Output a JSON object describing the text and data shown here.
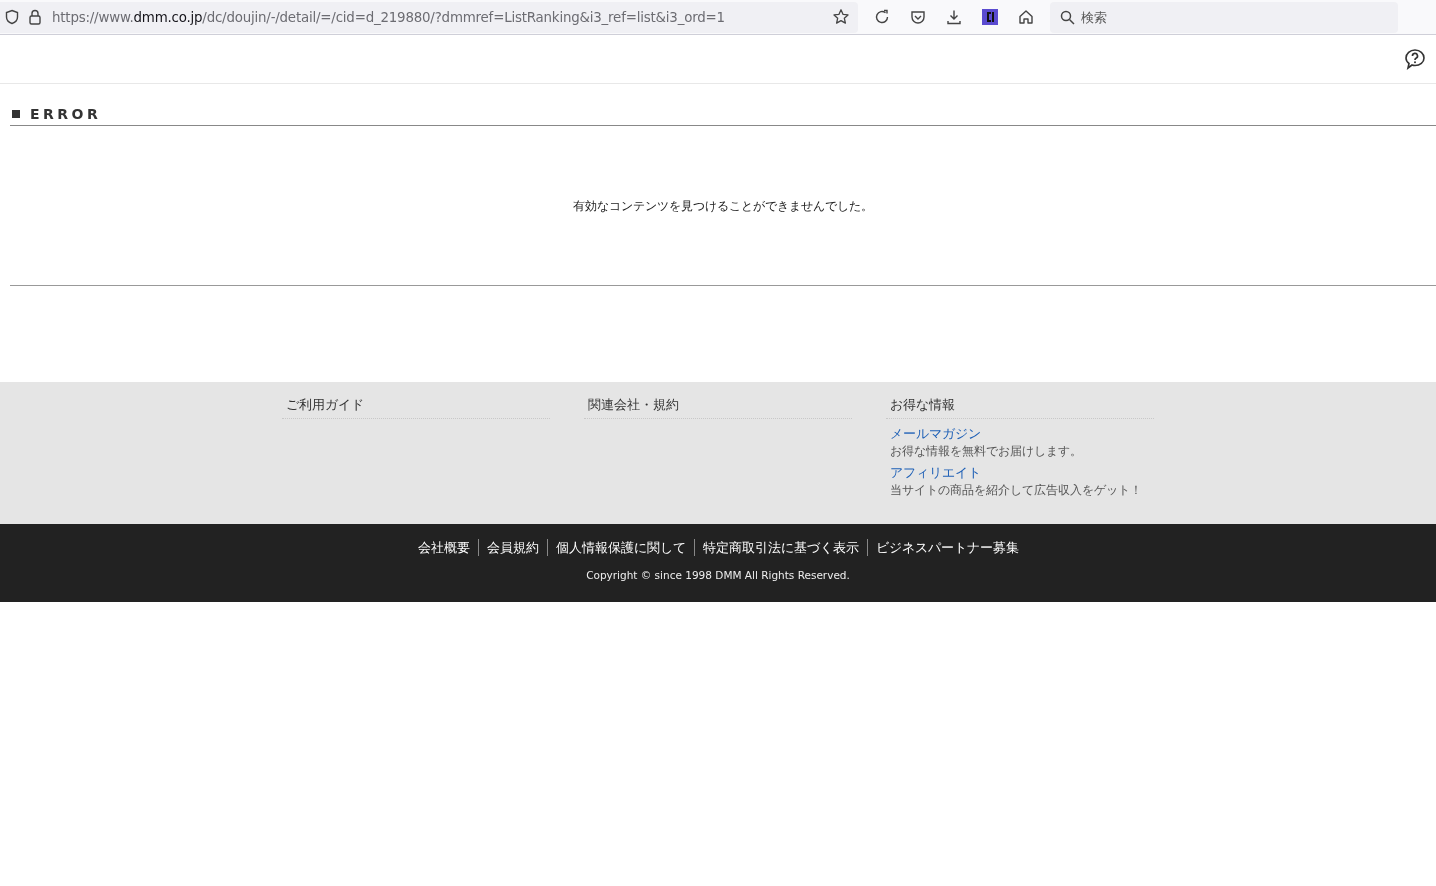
{
  "browser": {
    "url_prefix": "https://www.",
    "url_domain": "dmm.co.jp",
    "url_path": "/dc/doujin/-/detail/=/cid=d_219880/?dmmref=ListRanking&i3_ref=list&i3_ord=1",
    "search_placeholder": "検索"
  },
  "error": {
    "title": "ERROR",
    "message": "有効なコンテンツを見つけることができませんでした。"
  },
  "footer_columns": [
    {
      "heading": "ご利用ガイド"
    },
    {
      "heading": "関連会社・規約"
    },
    {
      "heading": "お得な情報",
      "links": [
        {
          "label": "メールマガジン",
          "description": "お得な情報を無料でお届けします。"
        },
        {
          "label": "アフィリエイト",
          "description": "当サイトの商品を紹介して広告収入をゲット！"
        }
      ]
    }
  ],
  "bottom_links": [
    "会社概要",
    "会員規約",
    "個人情報保護に関して",
    "特定商取引法に基づく表示",
    "ビジネスパートナー募集"
  ],
  "copyright": "Copyright © since 1998 DMM All Rights Reserved."
}
